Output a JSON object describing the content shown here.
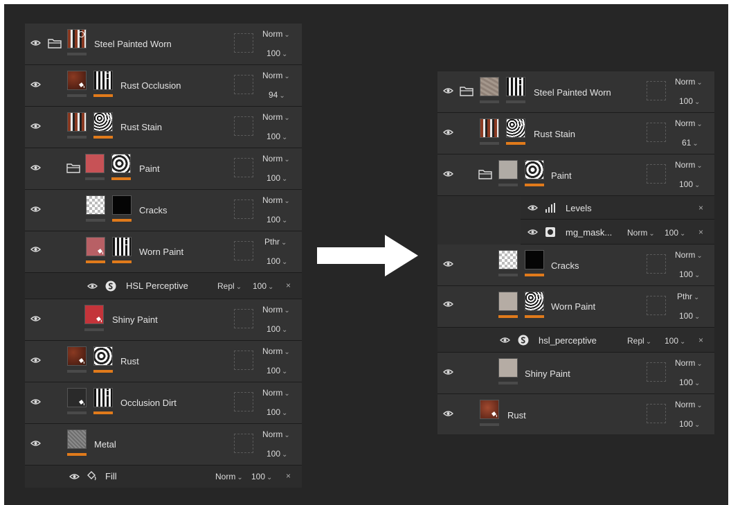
{
  "colors": {
    "background": "#262626",
    "panel": "#2d2d2d",
    "row": "#333333",
    "accent": "#e07a1b"
  },
  "left_panel": {
    "layers": [
      {
        "name": "Steel Painted Worn",
        "blend": "Norm",
        "opacity": "100"
      },
      {
        "name": "Rust Occlusion",
        "blend": "Norm",
        "opacity": "94"
      },
      {
        "name": "Rust Stain",
        "blend": "Norm",
        "opacity": "100"
      },
      {
        "name": "Paint",
        "blend": "Norm",
        "opacity": "100"
      },
      {
        "name": "Cracks",
        "blend": "Norm",
        "opacity": "100"
      },
      {
        "name": "Worn Paint",
        "blend": "Pthr",
        "opacity": "100"
      },
      {
        "name": "Shiny Paint",
        "blend": "Norm",
        "opacity": "100"
      },
      {
        "name": "Rust",
        "blend": "Norm",
        "opacity": "100"
      },
      {
        "name": "Occlusion Dirt",
        "blend": "Norm",
        "opacity": "100"
      },
      {
        "name": "Metal",
        "blend": "Norm",
        "opacity": "100"
      }
    ],
    "effects": [
      {
        "name": "HSL Perceptive",
        "blend": "Repl",
        "opacity": "100",
        "close": "×",
        "icon": "substance-icon"
      },
      {
        "name": "Fill",
        "blend": "Norm",
        "opacity": "100",
        "close": "×",
        "icon": "fill-bucket-icon"
      }
    ]
  },
  "right_panel": {
    "layers": [
      {
        "name": "Steel Painted Worn",
        "blend": "Norm",
        "opacity": "100"
      },
      {
        "name": "Rust Stain",
        "blend": "Norm",
        "opacity": "61"
      },
      {
        "name": "Paint",
        "blend": "Norm",
        "opacity": "100"
      },
      {
        "name": "Cracks",
        "blend": "Norm",
        "opacity": "100"
      },
      {
        "name": "Worn Paint",
        "blend": "Pthr",
        "opacity": "100"
      },
      {
        "name": "Shiny Paint",
        "blend": "Norm",
        "opacity": "100"
      },
      {
        "name": "Rust",
        "blend": "Norm",
        "opacity": "100"
      }
    ],
    "effects": [
      {
        "name": "Levels",
        "blend": "",
        "opacity": "",
        "close": "×",
        "icon": "levels-icon"
      },
      {
        "name": "mg_mask...",
        "blend": "Norm",
        "opacity": "100",
        "close": "×",
        "icon": "mask-generator-icon"
      },
      {
        "name": "hsl_perceptive",
        "blend": "Repl",
        "opacity": "100",
        "close": "×",
        "icon": "substance-icon"
      }
    ]
  },
  "arrow_icon": "right-arrow-icon"
}
